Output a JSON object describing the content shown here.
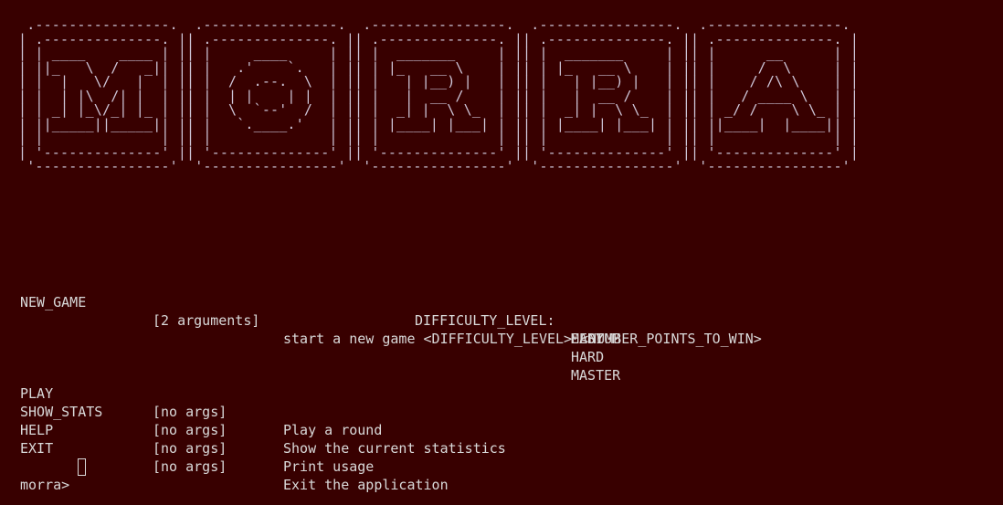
{
  "banner": {
    "art": " .----------------.  .----------------.  .----------------.  .----------------.  .----------------.\n| .--------------. || .--------------. || .--------------. || .--------------. || .--------------. |\n| | ____    ____ | || |     ____     | || |  _______     | || |  _______     | || |      __      | |\n| ||_   \\  /   _|| || |   .'    `.   | || | |_   __ \\    | || | |_   __ \\    | || |     /  \\     | |\n| |  |   \\/   |  | || |  /  .--.  \\  | || |   | |__) |   | || |   | |__) |   | || |    / /\\ \\    | |\n| |  | |\\  /| |  | || |  | |    | |  | || |   |  __ /    | || |   |  __ /    | || |   / ____ \\   | |\n| | _| |_\\/_| |_ | || |  \\  `--'  /  | || |  _| |  \\ \\_  | || |  _| |  \\ \\_  | || | _/ /    \\ \\_ | |\n| ||_____||_____|| || |   `.____.'   | || | |____| |___| | || | |____| |___| | || ||____|  |____|| |\n| |              | || |              | || |              | || |              | || |              | |\n| '--------------' || '--------------' || '--------------' || '--------------' || '--------------' |\n '----------------'  '----------------'  '----------------'  '----------------'  '----------------'"
  },
  "usage": {
    "new_game": {
      "command": "NEW_GAME",
      "args": "[2 arguments]",
      "description": "start a new game <DIFFICULTY_LEVEL> <NUMBER_POINTS_TO_WIN>",
      "difficulty_label": "DIFFICULTY_LEVEL:",
      "levels": [
        "EASY",
        "MEDIUM",
        "HARD",
        "MASTER"
      ]
    },
    "commands": [
      {
        "command": "PLAY",
        "args": "[no args]",
        "description": "Play a round"
      },
      {
        "command": "SHOW_STATS",
        "args": "[no args]",
        "description": "Show the current statistics"
      },
      {
        "command": "HELP",
        "args": "[no args]",
        "description": "Print usage"
      },
      {
        "command": "EXIT",
        "args": "[no args]",
        "description": "Exit the application"
      }
    ]
  },
  "prompt": {
    "label": "morra>",
    "input": ""
  },
  "colors": {
    "background": "#380000",
    "text": "#d9d9d9",
    "banner": "#cec6d8"
  }
}
